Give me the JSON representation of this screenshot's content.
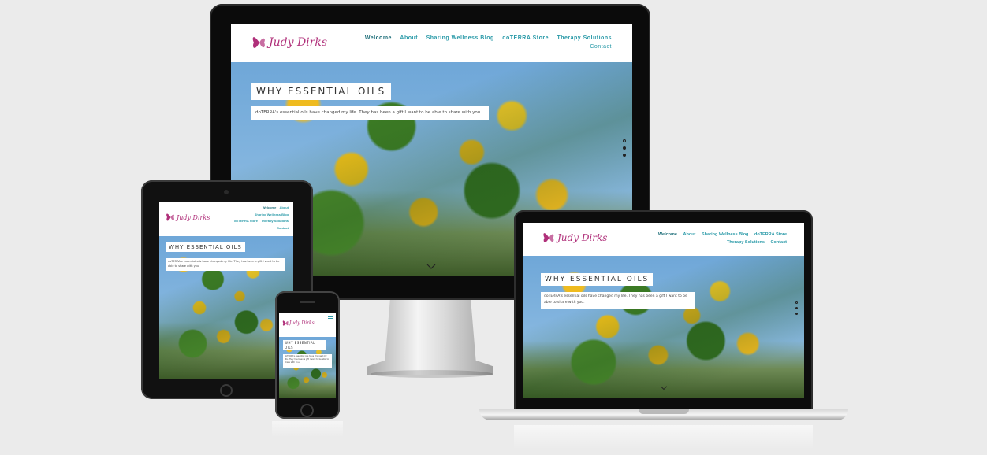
{
  "site": {
    "logo_text": "Judy Dirks",
    "nav": {
      "welcome": "Welcome",
      "about": "About",
      "blog": "Sharing Wellness Blog",
      "store": "doTERRA Store",
      "therapy": "Therapy Solutions",
      "contact": "Contact"
    },
    "hero_title": "WHY ESSENTIAL OILS",
    "hero_subtitle": "doTERRA's essential oils have changed my life. They has been a gift I want to be able to share with you."
  },
  "icons": {
    "logo": "butterfly-wing-icon",
    "scroll": "chevron-down-icon",
    "slider_dots": "slider-dot-icon",
    "mobile_menu": "menu-icon"
  },
  "colors": {
    "brand_magenta": "#b0307a",
    "nav_teal": "#2a9aa8",
    "background": "#ebebeb"
  }
}
